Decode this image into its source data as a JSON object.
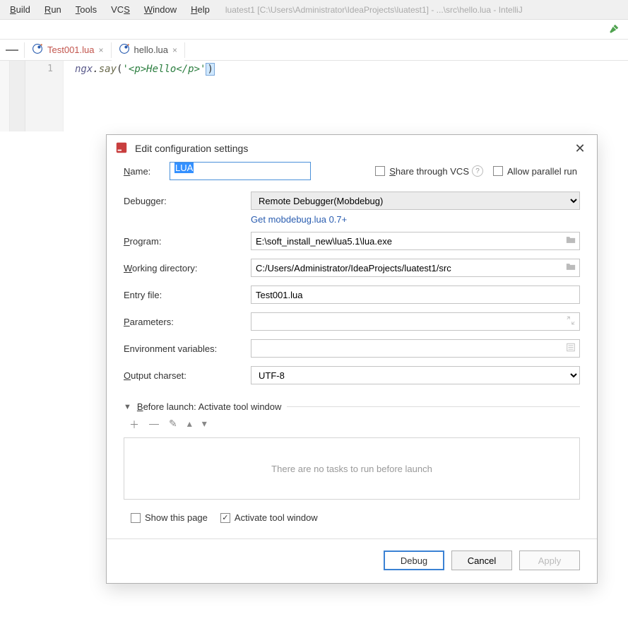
{
  "menubar": {
    "items": [
      "Build",
      "Run",
      "Tools",
      "VCS",
      "Window",
      "Help"
    ],
    "underlines": [
      "B",
      "R",
      "T",
      "S",
      "W",
      "H"
    ],
    "title_path": "luatest1 [C:\\Users\\Administrator\\IdeaProjects\\luatest1] - ...\\src\\hello.lua - IntelliJ"
  },
  "tabs": {
    "items": [
      {
        "label": "Test001.lua",
        "active": false
      },
      {
        "label": "hello.lua",
        "active": true
      }
    ]
  },
  "editor": {
    "line_number": "1",
    "code_obj": "ngx",
    "code_dot": ".",
    "code_fn": "say",
    "code_open": "(",
    "code_str": "'<p>Hello</p>'",
    "code_close": ")"
  },
  "dialog": {
    "title": "Edit configuration settings",
    "name_label": "Name:",
    "name_value": "LUA",
    "share_label": "Share through VCS",
    "allow_parallel_label": "Allow parallel run",
    "debugger_label": "Debugger:",
    "debugger_value": "Remote Debugger(Mobdebug)",
    "mobdebug_link": "Get mobdebug.lua 0.7+",
    "program_label": "Program:",
    "program_value": "E:\\soft_install_new\\lua5.1\\lua.exe",
    "working_dir_label": "Working directory:",
    "working_dir_value": "C:/Users/Administrator/IdeaProjects/luatest1/src",
    "entry_label": "Entry file:",
    "entry_value": "Test001.lua",
    "params_label": "Parameters:",
    "params_value": "",
    "env_label": "Environment variables:",
    "env_value": "",
    "charset_label": "Output charset:",
    "charset_value": "UTF-8",
    "before_launch_label": "Before launch: Activate tool window",
    "empty_tasks": "There are no tasks to run before launch",
    "show_page_label": "Show this page",
    "activate_window_label": "Activate tool window",
    "btn_debug": "Debug",
    "btn_cancel": "Cancel",
    "btn_apply": "Apply"
  }
}
